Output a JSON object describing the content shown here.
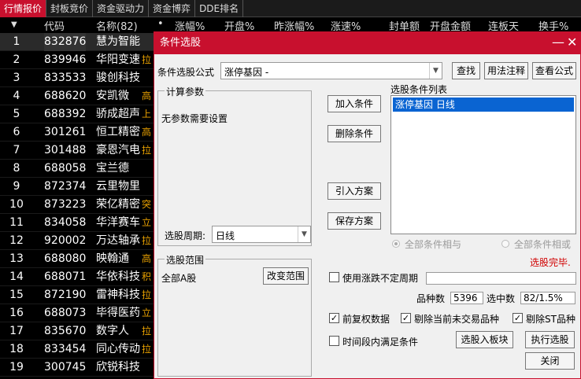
{
  "tabs": [
    "行情报价",
    "封板竞价",
    "资金驱动力",
    "资金博弈",
    "DDE排名"
  ],
  "table": {
    "headers": {
      "sort_icon": "▼",
      "code": "代码",
      "name": "名称(82)",
      "dot": "•",
      "change": "涨幅%",
      "open": "开盘%",
      "prev_change": "昨涨幅%",
      "speed": "涨速%",
      "seal_amount": "封单额",
      "open_amount": "开盘金额",
      "limit_days": "连板天",
      "turnover": "换手%"
    },
    "rows": [
      {
        "idx": "1",
        "code": "832876",
        "name": "慧为智能",
        "tag": ""
      },
      {
        "idx": "2",
        "code": "839946",
        "name": "华阳变速",
        "tag": "拉"
      },
      {
        "idx": "3",
        "code": "833533",
        "name": "骏创科技",
        "tag": ""
      },
      {
        "idx": "4",
        "code": "688620",
        "name": "安凯微",
        "tag": "高"
      },
      {
        "idx": "5",
        "code": "688392",
        "name": "骄成超声",
        "tag": "上"
      },
      {
        "idx": "6",
        "code": "301261",
        "name": "恒工精密",
        "tag": "高"
      },
      {
        "idx": "7",
        "code": "301488",
        "name": "豪恩汽电",
        "tag": "拉"
      },
      {
        "idx": "8",
        "code": "688058",
        "name": "宝兰德",
        "tag": ""
      },
      {
        "idx": "9",
        "code": "872374",
        "name": "云里物里",
        "tag": ""
      },
      {
        "idx": "10",
        "code": "873223",
        "name": "荣亿精密",
        "tag": "突"
      },
      {
        "idx": "11",
        "code": "834058",
        "name": "华洋赛车",
        "tag": "立"
      },
      {
        "idx": "12",
        "code": "920002",
        "name": "万达轴承",
        "tag": "拉"
      },
      {
        "idx": "13",
        "code": "688080",
        "name": "映翰通",
        "tag": "高"
      },
      {
        "idx": "14",
        "code": "688071",
        "name": "华依科技",
        "tag": "积"
      },
      {
        "idx": "15",
        "code": "872190",
        "name": "雷神科技",
        "tag": "拉"
      },
      {
        "idx": "16",
        "code": "688073",
        "name": "毕得医药",
        "tag": "立"
      },
      {
        "idx": "17",
        "code": "835670",
        "name": "数字人",
        "tag": "拉"
      },
      {
        "idx": "18",
        "code": "833454",
        "name": "同心传动",
        "tag": "拉"
      },
      {
        "idx": "19",
        "code": "300745",
        "name": "欣锐科技",
        "tag": ""
      }
    ]
  },
  "dialog": {
    "title": "条件选股",
    "min_icon": "—",
    "close_icon": "✕",
    "formula_label": "条件选股公式",
    "formula_value": "涨停基因  -",
    "btn_find": "查找",
    "btn_usage": "用法注释",
    "btn_view": "查看公式",
    "params_title": "计算参数",
    "params_text": "无参数需要设置",
    "period_label": "选股周期:",
    "period_value": "日线",
    "btn_add": "加入条件",
    "btn_delete": "删除条件",
    "btn_import": "引入方案",
    "btn_save": "保存方案",
    "list_title": "选股条件列表",
    "list_item": "涨停基因  日线",
    "radio_and": "全部条件相与",
    "radio_or": "全部条件相或",
    "status": "选股完毕.",
    "range_title": "选股范围",
    "range_value": "全部A股",
    "btn_change_range": "改变范围",
    "use_period_label": "使用涨跌不定周期",
    "count_label": "品种数",
    "count_value": "5396",
    "selected_label": "选中数",
    "selected_value": "82/1.5%",
    "cb_adjusted": "前复权数据",
    "cb_exclude_untraded": "剔除当前未交易品种",
    "cb_exclude_st": "剔除ST品种",
    "cb_time_range": "时间段内满足条件",
    "btn_to_sector": "选股入板块",
    "btn_execute": "执行选股",
    "btn_close": "关闭",
    "check_mark": "✓",
    "combo_arrow": "▼"
  }
}
